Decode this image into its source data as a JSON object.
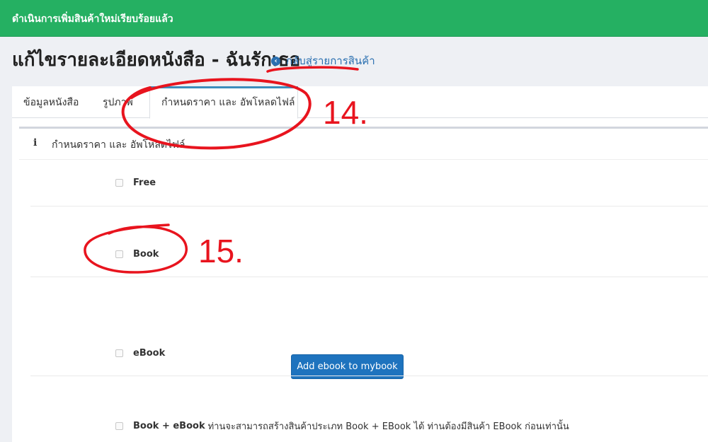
{
  "alert": {
    "message": "ดำเนินการเพิ่มสินค้าใหม่เรียบร้อยแล้ว",
    "color": "#25b062"
  },
  "page": {
    "title": "แก้ไขรายละเอียดหนังสือ - ฉันรักเธอ",
    "back_link": "กลับสู่รายการสินค้า"
  },
  "tabs": [
    {
      "label": "ข้อมูลหนังสือ",
      "active": false
    },
    {
      "label": "รูปภาพ",
      "active": false
    },
    {
      "label": "กำหนดราคา และ อัพโหลดไฟล์",
      "active": true
    }
  ],
  "section": {
    "title": "กำหนดราคา และ อัพโหลดไฟล์",
    "icon": "info-icon"
  },
  "options": {
    "free": {
      "label": "Free",
      "checked": false
    },
    "book": {
      "label": "Book",
      "checked": false
    },
    "ebook": {
      "label": "eBook",
      "checked": false,
      "button_label": "Add ebook to mybook"
    },
    "book_ebook": {
      "label": "Book + eBook",
      "note": "ท่านจะสามารถสร้างสินค้าประเภท Book + EBook ได้ ท่านต้องมีสินค้า EBook ก่อนเท่านั้น",
      "checked": false
    }
  },
  "annotations": {
    "step14": "14.",
    "step15": "15.",
    "color": "#e8141e"
  }
}
